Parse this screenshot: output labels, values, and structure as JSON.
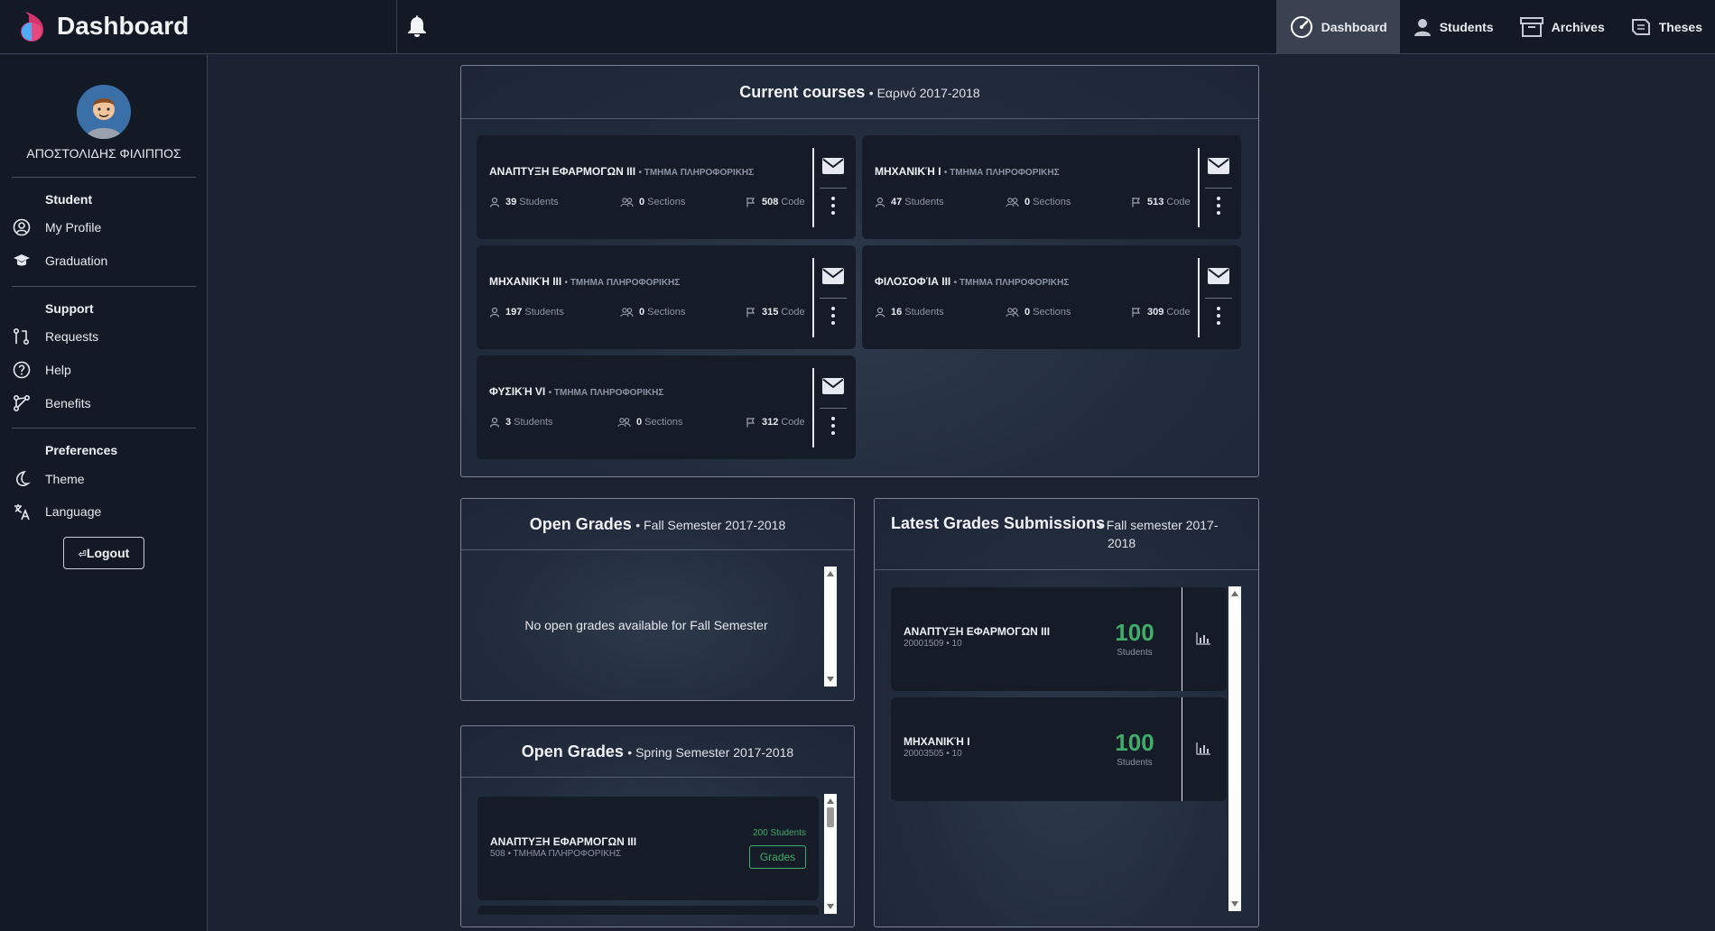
{
  "app": {
    "title": "Dashboard"
  },
  "nav": [
    {
      "label": "Dashboard",
      "icon": "dashboard-gauge-icon",
      "active": true
    },
    {
      "label": "Students",
      "icon": "user-icon",
      "active": false
    },
    {
      "label": "Archives",
      "icon": "archive-box-icon",
      "active": false
    },
    {
      "label": "Theses",
      "icon": "theses-icon",
      "active": false
    }
  ],
  "user": {
    "name": "ΑΠΟΣΤΟΛΙΔΗΣ ΦΙΛΙΠΠΟΣ"
  },
  "sidebar": {
    "student_head": "Student",
    "my_profile": "My Profile",
    "graduation": "Graduation",
    "support_head": "Support",
    "requests": "Requests",
    "help": "Help",
    "benefits": "Benefits",
    "prefs_head": "Preferences",
    "theme": "Theme",
    "language": "Language",
    "logout": "Logout"
  },
  "current_courses": {
    "title": "Current courses",
    "subtitle": "• Εαρινό 2017-2018",
    "courses": [
      {
        "name": "ΑΝΑΠΤΥΞΗ ΕΦΑΡΜΟΓΩΝ ΙΙΙ",
        "dept": "• ΤΜΗΜΑ ΠΛΗΡΟΦΟΡΙΚΗΣ",
        "students": "39",
        "students_label": "Students",
        "sections": "0",
        "sections_label": "Sections",
        "code": "508",
        "code_label": "Code"
      },
      {
        "name": "ΜΗΧΑΝΙΚΉ Ι",
        "dept": "• ΤΜΗΜΑ ΠΛΗΡΟΦΟΡΙΚΗΣ",
        "students": "47",
        "students_label": "Students",
        "sections": "0",
        "sections_label": "Sections",
        "code": "513",
        "code_label": "Code"
      },
      {
        "name": "ΜΗΧΑΝΙΚΉ ΙΙΙ",
        "dept": "• ΤΜΗΜΑ ΠΛΗΡΟΦΟΡΙΚΗΣ",
        "students": "197",
        "students_label": "Students",
        "sections": "0",
        "sections_label": "Sections",
        "code": "315",
        "code_label": "Code"
      },
      {
        "name": "ΦΙΛΟΣΟΦΊΑ ΙΙΙ",
        "dept": "• ΤΜΗΜΑ ΠΛΗΡΟΦΟΡΙΚΗΣ",
        "students": "16",
        "students_label": "Students",
        "sections": "0",
        "sections_label": "Sections",
        "code": "309",
        "code_label": "Code"
      },
      {
        "name": "ΦΥΣΙΚΉ VI",
        "dept": "• ΤΜΗΜΑ ΠΛΗΡΟΦΟΡΙΚΗΣ",
        "students": "3",
        "students_label": "Students",
        "sections": "0",
        "sections_label": "Sections",
        "code": "312",
        "code_label": "Code"
      }
    ]
  },
  "open_grades_fall": {
    "title": "Open Grades",
    "subtitle": "• Fall Semester 2017-2018",
    "empty_text": "No open grades available for Fall Semester"
  },
  "open_grades_spring": {
    "title": "Open Grades",
    "subtitle": "• Spring Semester 2017-2018",
    "items": [
      {
        "name": "ΑΝΑΠΤΥΞΗ ΕΦΑΡΜΟΓΩΝ ΙΙΙ",
        "meta": "508 • ΤΜΗΜΑ ΠΛΗΡΟΦΟΡΙΚΗΣ",
        "students": "200 Students",
        "button": "Grades"
      }
    ]
  },
  "latest_submissions": {
    "title": "Latest Grades Submissions",
    "subtitle_line1": "• Fall semester 2017-",
    "subtitle_line2": "2018",
    "items": [
      {
        "name": "ΑΝΑΠΤΥΞΗ ΕΦΑΡΜΟΓΩΝ ΙΙΙ",
        "meta": "20001509 • 10",
        "count": "100",
        "count_label": "Students"
      },
      {
        "name": "ΜΗΧΑΝΙΚΉ Ι",
        "meta": "20003505 • 10",
        "count": "100",
        "count_label": "Students"
      }
    ]
  },
  "colors": {
    "accent_green": "#3fae6a",
    "logo_pink": "#d6336c",
    "logo_blue": "#4dabf7"
  }
}
